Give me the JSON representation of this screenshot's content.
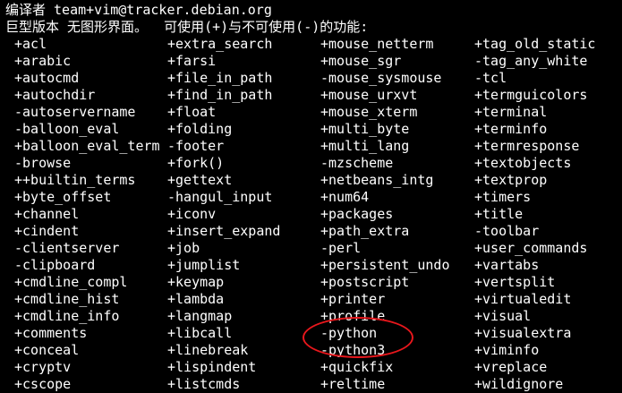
{
  "header": {
    "compiler_line": "编译者 team+vim@tracker.debian.org",
    "version_line": "巨型版本 无图形界面。  可使用(+)与不可使用(-)的功能:"
  },
  "colors": {
    "background": "#000000",
    "text": "#ffffff",
    "annotation": "#e8171c"
  },
  "features": [
    [
      "+acl",
      "+extra_search",
      "+mouse_netterm",
      "+tag_old_static"
    ],
    [
      "+arabic",
      "+farsi",
      "+mouse_sgr",
      "-tag_any_white"
    ],
    [
      "+autocmd",
      "+file_in_path",
      "-mouse_sysmouse",
      "-tcl"
    ],
    [
      "+autochdir",
      "+find_in_path",
      "+mouse_urxvt",
      "+termguicolors"
    ],
    [
      "-autoservername",
      "+float",
      "+mouse_xterm",
      "+terminal"
    ],
    [
      "-balloon_eval",
      "+folding",
      "+multi_byte",
      "+terminfo"
    ],
    [
      "+balloon_eval_term",
      "-footer",
      "+multi_lang",
      "+termresponse"
    ],
    [
      "-browse",
      "+fork()",
      "-mzscheme",
      "+textobjects"
    ],
    [
      "++builtin_terms",
      "+gettext",
      "+netbeans_intg",
      "+textprop"
    ],
    [
      "+byte_offset",
      "-hangul_input",
      "+num64",
      "+timers"
    ],
    [
      "+channel",
      "+iconv",
      "+packages",
      "+title"
    ],
    [
      "+cindent",
      "+insert_expand",
      "+path_extra",
      "-toolbar"
    ],
    [
      "-clientserver",
      "+job",
      "-perl",
      "+user_commands"
    ],
    [
      "-clipboard",
      "+jumplist",
      "+persistent_undo",
      "+vartabs"
    ],
    [
      "+cmdline_compl",
      "+keymap",
      "+postscript",
      "+vertsplit"
    ],
    [
      "+cmdline_hist",
      "+lambda",
      "+printer",
      "+virtualedit"
    ],
    [
      "+cmdline_info",
      "+langmap",
      "+profile",
      "+visual"
    ],
    [
      "+comments",
      "+libcall",
      "-python",
      "+visualextra"
    ],
    [
      "+conceal",
      "+linebreak",
      "-python3",
      "+viminfo"
    ],
    [
      "+cryptv",
      "+lispindent",
      "+quickfix",
      "+vreplace"
    ],
    [
      "+cscope",
      "+listcmds",
      "+reltime",
      "+wildignore"
    ]
  ]
}
